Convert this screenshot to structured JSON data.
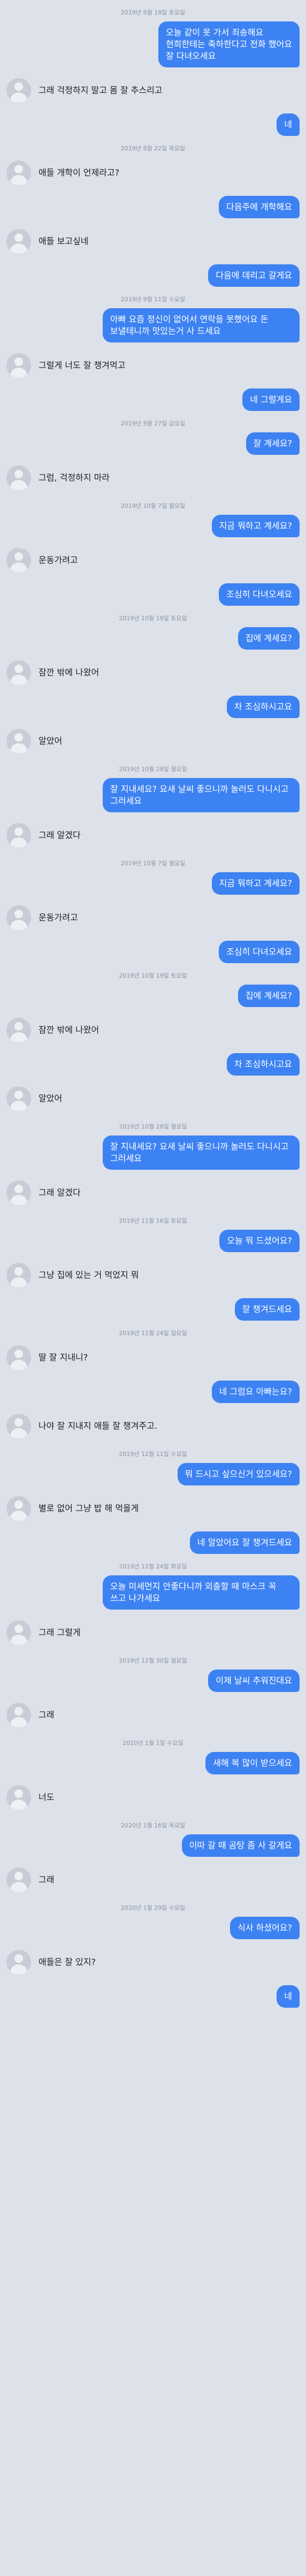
{
  "colors": {
    "background": "#dde1e9",
    "sent_bubble": "#3d82f2",
    "sent_text": "#ffffff",
    "received_text": "#1c1f26",
    "date_text": "#8b93a1",
    "avatar": "#c7ccd6"
  },
  "icons": {
    "avatar": "user-silhouette-icon"
  },
  "messages": [
    {
      "type": "date",
      "text": "2019년 8월 18일 토요일"
    },
    {
      "type": "me",
      "text": "오늘 같이 못 가서 죄송해요\n현희한테는 축하한다고 전화 했어요\n잘 다녀오세요"
    },
    {
      "type": "them",
      "text": "그래 걱정하지 말고 몸 잘 추스리고"
    },
    {
      "type": "me",
      "text": "네"
    },
    {
      "type": "date",
      "text": "2019년 8월 22일 목요일"
    },
    {
      "type": "them",
      "text": "애들 개학이 언제라고?"
    },
    {
      "type": "me",
      "text": "다음주에 개학해요"
    },
    {
      "type": "them",
      "text": "애들 보고싶네"
    },
    {
      "type": "me",
      "text": "다음에 데리고 갈게요"
    },
    {
      "type": "date",
      "text": "2019년 9월 11일 수요일"
    },
    {
      "type": "me",
      "text": "아빠 요즘 정신이 없어서 연락을 못했어요 돈 보낼테니까 맛있는거 사 드세요"
    },
    {
      "type": "them",
      "text": "그럴게 너도 잘 챙겨먹고"
    },
    {
      "type": "me",
      "text": "네 그럴게요"
    },
    {
      "type": "date",
      "text": "2019년 9월 27일 금요일"
    },
    {
      "type": "me",
      "text": "잘 계세요?"
    },
    {
      "type": "them",
      "text": "그럼, 걱정하지 마라"
    },
    {
      "type": "date",
      "text": "2019년 10월 7일 월요일"
    },
    {
      "type": "me",
      "text": "지금 뭐하고 계세요?"
    },
    {
      "type": "them",
      "text": "운동가려고"
    },
    {
      "type": "me",
      "text": "조심히 다녀오세요"
    },
    {
      "type": "date",
      "text": "2019년 10월 19일 토요일"
    },
    {
      "type": "me",
      "text": "집에 계세요?"
    },
    {
      "type": "them",
      "text": "잠깐 밖에 나왔어"
    },
    {
      "type": "me",
      "text": "차 조심하시고요"
    },
    {
      "type": "them",
      "text": "알았어"
    },
    {
      "type": "date",
      "text": "2019년 10월 28일 월요일"
    },
    {
      "type": "me",
      "text": "잘 지내세요? 요새 날씨 좋으니까 놀러도 다니시고 그러세요"
    },
    {
      "type": "them",
      "text": "그래 알겠다"
    },
    {
      "type": "date",
      "text": "2019년 10월 7일 월요일"
    },
    {
      "type": "me",
      "text": "지금 뭐하고 계세요?"
    },
    {
      "type": "them",
      "text": "운동가려고"
    },
    {
      "type": "me",
      "text": "조심히 다녀오세요"
    },
    {
      "type": "date",
      "text": "2019년 10월 19일 토요일"
    },
    {
      "type": "me",
      "text": "집에 계세요?"
    },
    {
      "type": "them",
      "text": "잠깐 밖에 나왔어"
    },
    {
      "type": "me",
      "text": "차 조심하시고요"
    },
    {
      "type": "them",
      "text": "알았어"
    },
    {
      "type": "date",
      "text": "2019년 10월 28일 월요일"
    },
    {
      "type": "me",
      "text": "잘 지내세요? 요새 날씨 좋으니까 놀러도 다니시고 그러세요"
    },
    {
      "type": "them",
      "text": "그래 알겠다"
    },
    {
      "type": "date",
      "text": "2019년 11월 16일 토요일"
    },
    {
      "type": "me",
      "text": "오늘 뭐 드셨어요?"
    },
    {
      "type": "them",
      "text": "그냥 집에 있는 거 먹었지 뭐"
    },
    {
      "type": "me",
      "text": "잘 챙겨드세요"
    },
    {
      "type": "date",
      "text": "2019년 11월 24일 일요일"
    },
    {
      "type": "them",
      "text": "딸 잘 지내니?"
    },
    {
      "type": "me",
      "text": "네 그럼요 아빠는요?"
    },
    {
      "type": "them",
      "text": "나야 잘 지내지 애들 잘 챙겨주고."
    },
    {
      "type": "date",
      "text": "2019년 12월 11일 수요일"
    },
    {
      "type": "me",
      "text": "뭐 드시고 싶으신거 있으세요?"
    },
    {
      "type": "them",
      "text": "별로 없어 그냥 밥 해 먹을게"
    },
    {
      "type": "me",
      "text": "네 알았어요 잘 챙겨드세요"
    },
    {
      "type": "date",
      "text": "2019년 12월 24일 화요일"
    },
    {
      "type": "me",
      "text": "오늘 미세먼지 안좋다니까 외출할 때 마스크 꼭 쓰고 나가세요"
    },
    {
      "type": "them",
      "text": "그래 그럴게"
    },
    {
      "type": "date",
      "text": "2019년 12월 30일 월요일"
    },
    {
      "type": "me",
      "text": "이제 날씨 추워진대요"
    },
    {
      "type": "them",
      "text": "그래"
    },
    {
      "type": "date",
      "text": "2020년 1월 1일 수요일"
    },
    {
      "type": "me",
      "text": "새해 복 많이 받으세요"
    },
    {
      "type": "them",
      "text": "너도"
    },
    {
      "type": "date",
      "text": "2020년 1월 16일 목요일"
    },
    {
      "type": "me",
      "text": "이따 갈 때 곰탕 좀 사 갈게요"
    },
    {
      "type": "them",
      "text": "그래"
    },
    {
      "type": "date",
      "text": "2020년 1월 29일 수요일"
    },
    {
      "type": "me",
      "text": "식사 하셨어요?"
    },
    {
      "type": "them",
      "text": "애들은 잘 있지?"
    },
    {
      "type": "me",
      "text": "네"
    }
  ]
}
